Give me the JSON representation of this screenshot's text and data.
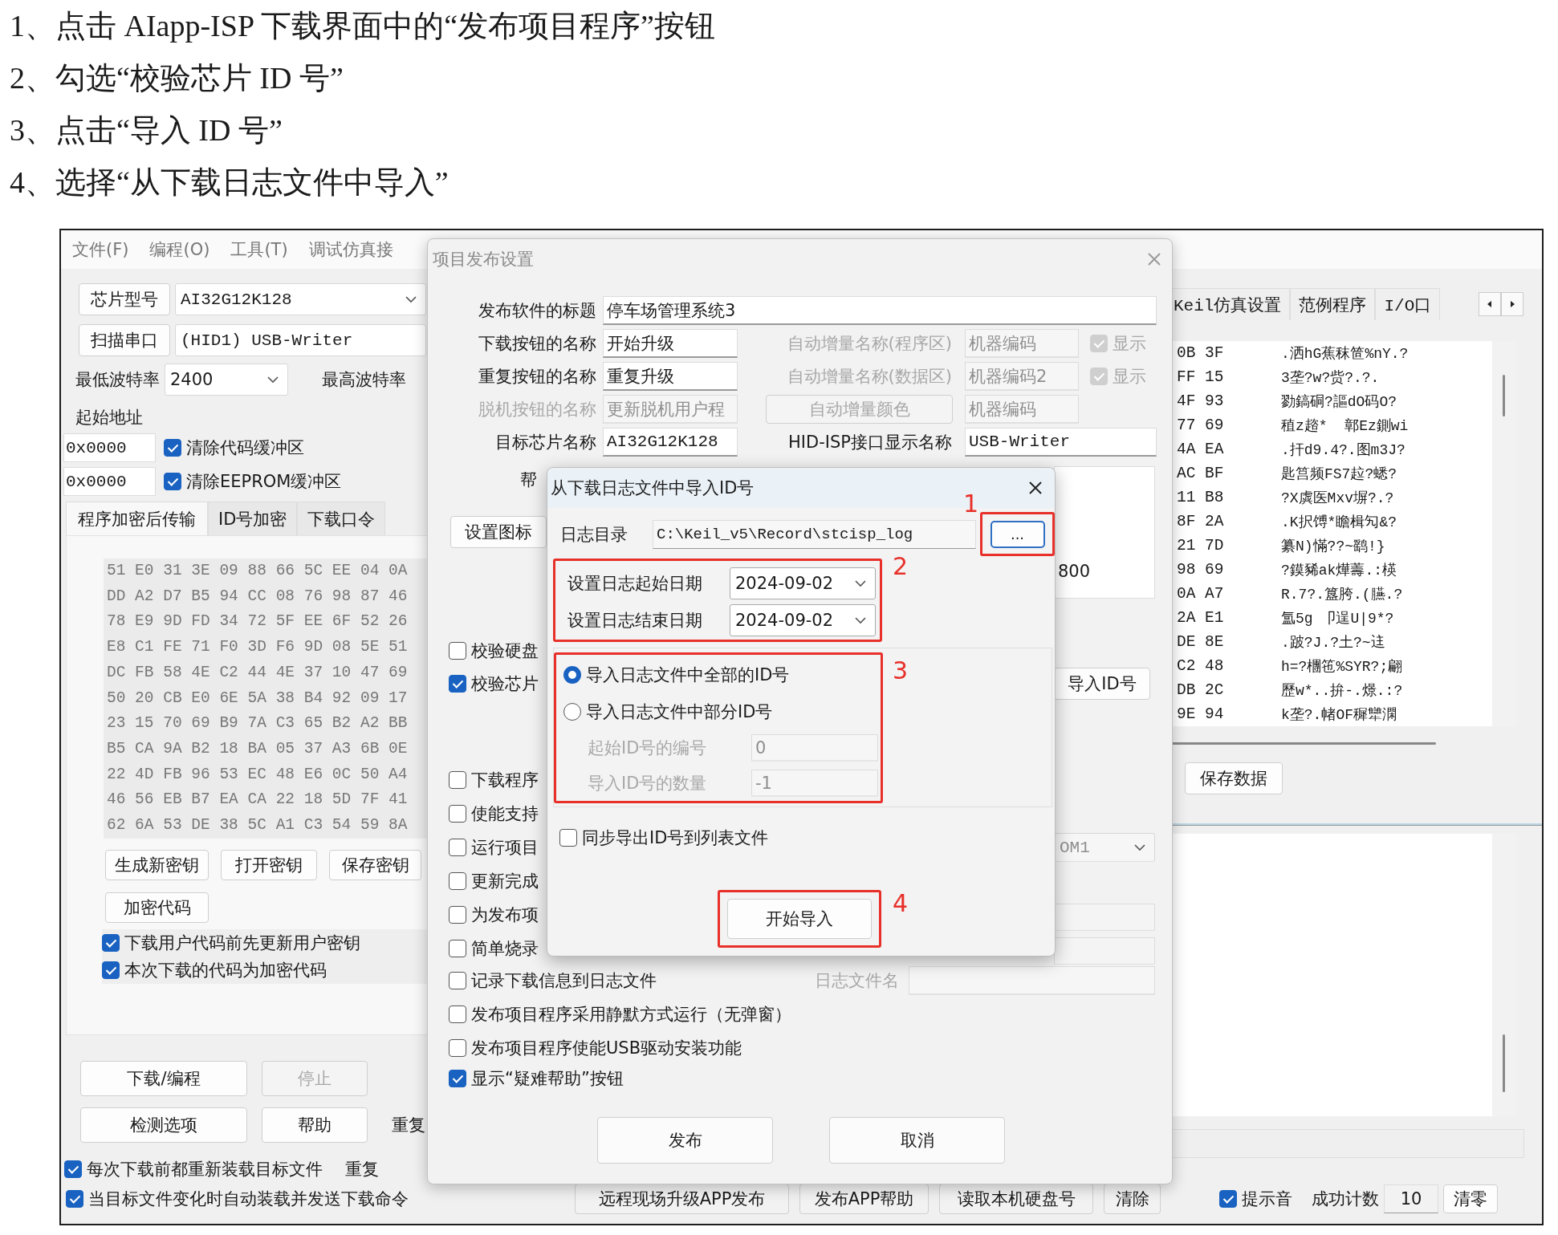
{
  "instructions": [
    "1、点击 AIapp-ISP 下载界面中的“发布项目程序”按钮",
    "2、勾选“校验芯片 ID 号”",
    "3、点击“导入 ID 号”",
    "4、选择“从下载日志文件中导入”"
  ],
  "main_window": {
    "menu": [
      "文件(F)",
      "编程(O)",
      "工具(T)",
      "调试仿真接"
    ],
    "chip": {
      "button": "芯片型号",
      "value": "AI32G12K128"
    },
    "port": {
      "button": "扫描串口",
      "value": "(HID1) USB-Writer"
    },
    "baud": {
      "min_label": "最低波特率",
      "min_value": "2400",
      "max_label": "最高波特率"
    },
    "start_address_label": "起始地址",
    "address_rows": [
      {
        "value": "0x0000",
        "label": "清除代码缓冲区",
        "checked": true
      },
      {
        "value": "0x0000",
        "label": "清除EEPROM缓冲区",
        "checked": true
      }
    ],
    "tabs": [
      {
        "label": "程序加密后传输",
        "selected": true
      },
      {
        "label": "ID号加密",
        "selected": false
      },
      {
        "label": "下载口令",
        "selected": false
      }
    ],
    "hex_rows": [
      "51 E0 31 3E 09 88 66 5C EE 04 0A",
      "DD A2 D7 B5 94 CC 08 76 98 87 46",
      "78 E9 9D FD 34 72 5F EE 6F 52 26",
      "E8 C1 FE 71 F0 3D F6 9D 08 5E 51",
      "DC FB 58 4E C2 44 4E 37 10 47 69",
      "50 20 CB E0 6E 5A 38 B4 92 09 17",
      "23 15 70 69 B9 7A C3 65 B2 A2 BB",
      "B5 CA 9A B2 18 BA 05 37 A3 6B 0E",
      "22 4D FB 96 53 EC 48 E6 0C 50 A4",
      "46 56 EB B7 EA CA 22 18 5D 7F 41",
      "62 6A 53 DE 38 5C A1 C3 54 59 8A"
    ],
    "key_buttons": [
      "生成新密钥",
      "打开密钥",
      "保存密钥"
    ],
    "encrypt_button": "加密代码",
    "encrypt_options": [
      {
        "label": "下载用户代码前先更新用户密钥",
        "checked": true
      },
      {
        "label": "本次下载的代码为加密代码",
        "checked": true
      }
    ],
    "action_rows": [
      {
        "buttons": [
          {
            "label": "下载/编程",
            "disabled": false
          },
          {
            "label": "停止",
            "disabled": true
          }
        ]
      },
      {
        "buttons": [
          {
            "label": "检测选项",
            "disabled": false
          },
          {
            "label": "帮助",
            "disabled": false
          }
        ],
        "note": "重复"
      }
    ],
    "reload_option": {
      "label": "每次下载前都重新装载目标文件",
      "checked": true,
      "note": "重复"
    },
    "auto_send_option": {
      "label": "当目标文件变化时自动装载并发送下载命令",
      "checked": true
    },
    "right_tabs": [
      {
        "label": "Keil仿真设置",
        "selected": false
      },
      {
        "label": "范例程序",
        "selected": false
      },
      {
        "label": "I/O口",
        "selected": false
      }
    ],
    "right_hex": [
      {
        "hex": "0B 3F",
        "text": ".洒hG蕉秣笸%nY.?"
      },
      {
        "hex": "FF 15",
        "text": "3垄?w?赀?.?."
      },
      {
        "hex": "4F 93",
        "text": "勠鎬硐?謳dO码O?"
      },
      {
        "hex": "77 69",
        "text": "稙z趦*  鄣Ez鍘wi"
      },
      {
        "hex": "4A EA",
        "text": ".扞d9.4?.图m3J?"
      },
      {
        "hex": "AC BF",
        "text": "匙筥频FS7趇?蟋?"
      },
      {
        "hex": "11 B8",
        "text": "?X虡医Mxv塀?.?"
      },
      {
        "hex": "8F 2A",
        "text": ".K択馎*瞻楫勼&?"
      },
      {
        "hex": "21 7D",
        "text": "纂N)慲??~鹞!}"
      },
      {
        "hex": "98 69",
        "text": "?鏌豨ak燁薵.:楧"
      },
      {
        "hex": "0A A7",
        "text": "R.7?.簋胯.(臙.?"
      },
      {
        "hex": "2A E1",
        "text": "氲5g 卩逞U|9*?"
      },
      {
        "hex": "DE 8E",
        "text": ".跛?J.?土?~迬"
      },
      {
        "hex": "C2 48",
        "text": "h=?檲竾%SYR?;翩"
      },
      {
        "hex": "DB 2C",
        "text": "歷w*..拚-.燝.:?"
      },
      {
        "hex": "9E 94",
        "text": "k垄?.帾OF穉犫澖"
      }
    ],
    "save_button": "保存数据",
    "bottom_buttons": [
      "远程现场升级APP发布",
      "发布APP帮助",
      "读取本机硬盘号",
      "清除"
    ],
    "beep": {
      "label": "提示音",
      "checked": true
    },
    "count": {
      "label": "成功计数",
      "value": "10",
      "button": "清零"
    }
  },
  "publish_dialog": {
    "title": "项目发布设置",
    "software_title": {
      "label": "发布软件的标题",
      "value": "停车场管理系统3"
    },
    "rows": [
      {
        "name": {
          "label": "下载按钮的名称",
          "value": "开始升级",
          "disabled": false
        },
        "right": {
          "kind": "counter",
          "label": "自动增量名称(程序区)",
          "value": "机器编码",
          "disabled": true,
          "check": {
            "label": "显示",
            "checked": true
          }
        }
      },
      {
        "name": {
          "label": "重复按钮的名称",
          "value": "重复升级",
          "disabled": false
        },
        "right": {
          "kind": "counter",
          "label": "自动增量名称(数据区)",
          "value": "机器编码2",
          "disabled": true,
          "check": {
            "label": "显示",
            "checked": true
          }
        }
      },
      {
        "name": {
          "label": "脱机按钮的名称",
          "value": "更新脱机用户程",
          "disabled": true
        },
        "right": {
          "kind": "color",
          "button": "自动增量颜色",
          "value": "机器编码",
          "disabled": true
        }
      },
      {
        "name": {
          "label": "目标芯片名称",
          "value": "AI32G12K128",
          "disabled": false
        },
        "right": {
          "kind": "interface",
          "label": "HID-ISP接口显示名称",
          "value": "USB-Writer",
          "disabled": false
        }
      }
    ],
    "help_label": "帮",
    "help_text": "800",
    "icon_button": "设置图标",
    "verify_options": [
      {
        "label": "校验硬盘",
        "checked": false
      },
      {
        "label": "校验芯片",
        "checked": true
      }
    ],
    "import_button": "导入ID号",
    "port_value": "OM1",
    "options": [
      {
        "label": "下载程序",
        "checked": false
      },
      {
        "label": "使能支持",
        "checked": false
      },
      {
        "label": "运行项目",
        "checked": false
      },
      {
        "label": "更新完成",
        "checked": false
      },
      {
        "label": "为发布项",
        "checked": false
      },
      {
        "label": "简单烧录",
        "checked": false
      }
    ],
    "log_option": {
      "label": "记录下载信息到日志文件",
      "checked": false,
      "file_label": "日志文件名"
    },
    "more_options": [
      {
        "label": "发布项目程序采用静默方式运行（无弹窗）",
        "checked": false
      },
      {
        "label": "发布项目程序使能USB驱动安装功能",
        "checked": false
      },
      {
        "label": "显示“疑难帮助”按钮",
        "checked": true
      }
    ],
    "buttons": [
      "发布",
      "取消"
    ]
  },
  "import_dialog": {
    "title": "从下载日志文件中导入ID号",
    "dir": {
      "label": "日志目录",
      "value": "C:\\Keil_v5\\Record\\stcisp_log",
      "button": "..."
    },
    "dates": [
      {
        "label": "设置日志起始日期",
        "value": "2024-09-02"
      },
      {
        "label": "设置日志结束日期",
        "value": "2024-09-02"
      }
    ],
    "modes": [
      {
        "label": "导入日志文件中全部的ID号",
        "selected": true
      },
      {
        "label": "导入日志文件中部分ID号",
        "selected": false
      }
    ],
    "range": [
      {
        "label": "起始ID号的编号",
        "value": "0",
        "disabled": true
      },
      {
        "label": "导入ID号的数量",
        "value": "-1",
        "disabled": true
      }
    ],
    "export_option": {
      "label": "同步导出ID号到列表文件",
      "checked": false
    },
    "start_button": "开始导入",
    "annotations": [
      "1",
      "2",
      "3",
      "4"
    ]
  }
}
